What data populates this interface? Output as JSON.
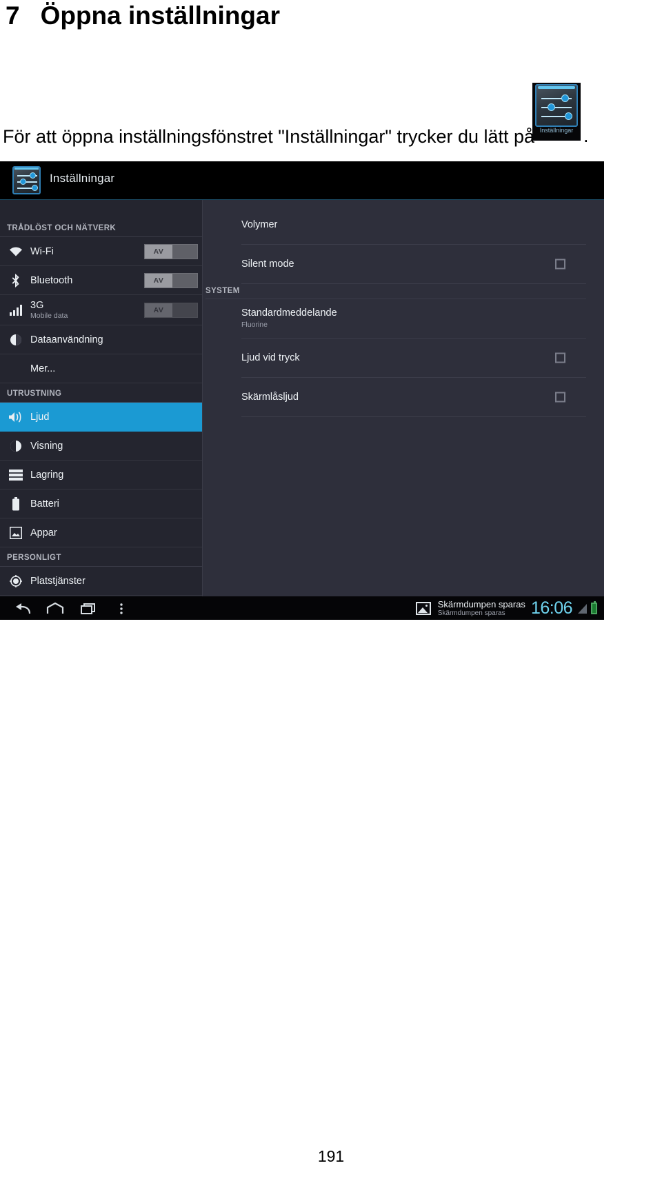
{
  "document": {
    "section_number": "7",
    "section_title": "Öppna inställningar",
    "body_text": "För att öppna inställningsfönstret \"Inställningar\" trycker du lätt på",
    "body_text_suffix": ".",
    "page_number": "191"
  },
  "inline_app_icon": {
    "label": "Inställningar",
    "icon": "settings-sliders-icon"
  },
  "screenshot": {
    "header": {
      "icon": "settings-sliders-icon",
      "title": "Inställningar"
    },
    "sidebar": {
      "sections": [
        {
          "header": "TRÅDLÖST OCH NÄTVERK",
          "items": [
            {
              "label": "Wi-Fi",
              "sub": "",
              "icon": "wifi-icon",
              "toggle": "AV",
              "selected": false
            },
            {
              "label": "Bluetooth",
              "sub": "",
              "icon": "bluetooth-icon",
              "toggle": "AV",
              "selected": false
            },
            {
              "label": "3G",
              "sub": "Mobile data",
              "icon": "signal-bars-icon",
              "toggle": "AV",
              "selected": false
            },
            {
              "label": "Dataanvändning",
              "sub": "",
              "icon": "data-usage-icon",
              "toggle": "",
              "selected": false
            },
            {
              "label": "Mer...",
              "sub": "",
              "icon": "",
              "toggle": "",
              "selected": false
            }
          ]
        },
        {
          "header": "UTRUSTNING",
          "items": [
            {
              "label": "Ljud",
              "sub": "",
              "icon": "speaker-icon",
              "toggle": "",
              "selected": true
            },
            {
              "label": "Visning",
              "sub": "",
              "icon": "brightness-icon",
              "toggle": "",
              "selected": false
            },
            {
              "label": "Lagring",
              "sub": "",
              "icon": "storage-icon",
              "toggle": "",
              "selected": false
            },
            {
              "label": "Batteri",
              "sub": "",
              "icon": "battery-icon",
              "toggle": "",
              "selected": false
            },
            {
              "label": "Appar",
              "sub": "",
              "icon": "apps-icon",
              "toggle": "",
              "selected": false
            }
          ]
        },
        {
          "header": "PERSONLIGT",
          "items": [
            {
              "label": "Platstjänster",
              "sub": "",
              "icon": "location-icon",
              "toggle": "",
              "selected": false
            }
          ]
        }
      ]
    },
    "pane": {
      "rows": [
        {
          "label": "Volymer",
          "sub": "",
          "checkbox": false
        },
        {
          "label": "Silent mode",
          "sub": "",
          "checkbox": true
        }
      ],
      "system_header": "SYSTEM",
      "system_rows": [
        {
          "label": "Standardmeddelande",
          "sub": "Fluorine",
          "checkbox": false
        },
        {
          "label": "Ljud vid tryck",
          "sub": "",
          "checkbox": true
        },
        {
          "label": "Skärmlåsljud",
          "sub": "",
          "checkbox": true
        }
      ]
    },
    "navbar": {
      "back_icon": "back-arrow-icon",
      "home_icon": "home-icon",
      "recents_icon": "recent-apps-icon",
      "menu_icon": "overflow-menu-icon",
      "notification": {
        "icon": "screenshot-image-icon",
        "title": "Skärmdumpen sparas",
        "subtitle": "Skärmdumpen sparas"
      },
      "clock": "16:06",
      "signal_icon": "signal-icon",
      "battery_icon": "battery-icon"
    }
  },
  "colors": {
    "accent_blue": "#1b9ad3",
    "panel_bg": "#2e2f3b",
    "sidebar_bg": "#24252f",
    "clock_cyan": "#6fd4ef"
  }
}
